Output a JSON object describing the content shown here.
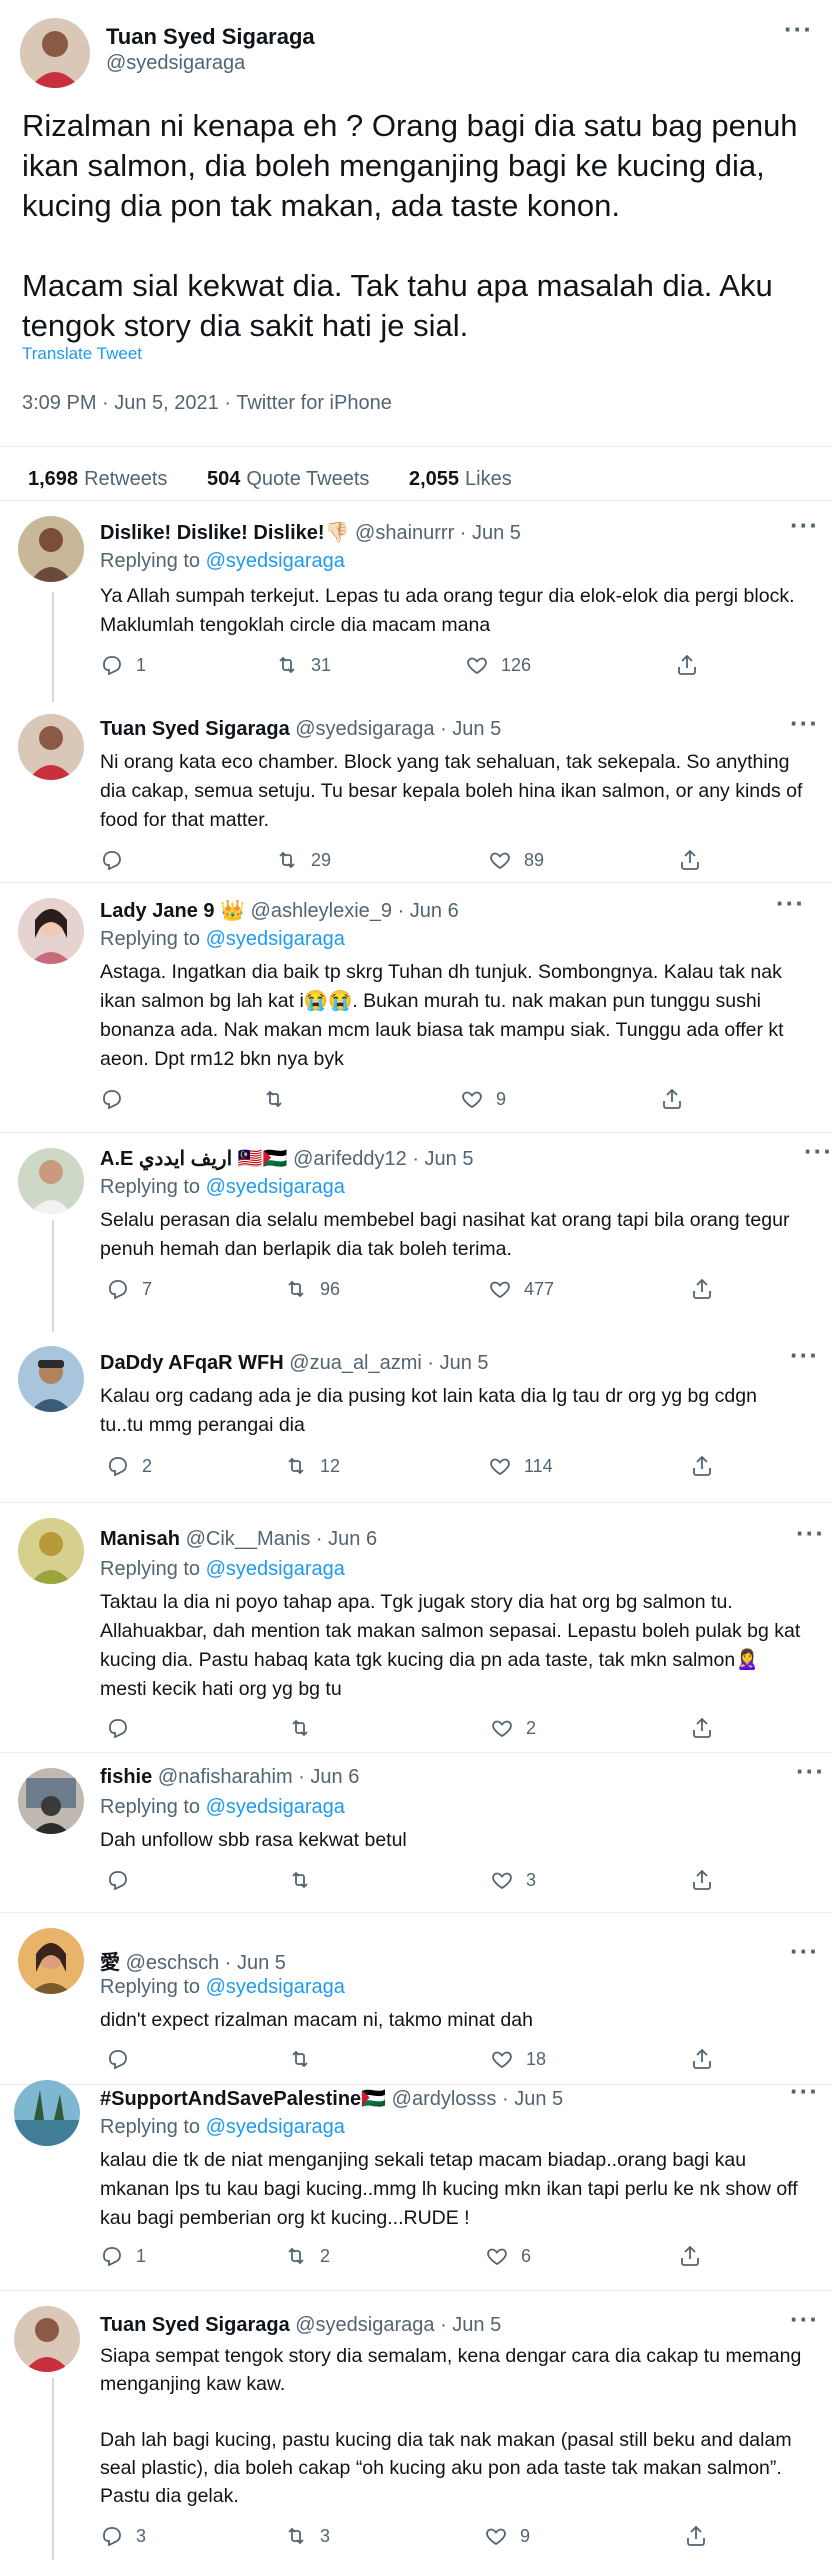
{
  "main_tweet": {
    "name": "Tuan Syed Sigaraga",
    "handle": "@syedsigaraga",
    "text": "Rizalman ni kenapa eh ? Orang bagi dia satu bag penuh ikan salmon, dia boleh menganjing bagi ke kucing dia, kucing dia pon tak makan, ada taste konon.\n\nMacam sial kekwat dia. Tak tahu apa masalah dia. Aku tengok story dia sakit hati je sial.",
    "translate": "Translate Tweet",
    "meta": "3:09 PM · Jun 5, 2021 · Twitter for iPhone",
    "stats": {
      "retweets_count": "1,698",
      "retweets_label": "Retweets",
      "quotes_count": "504",
      "quotes_label": "Quote Tweets",
      "likes_count": "2,055",
      "likes_label": "Likes"
    }
  },
  "replies": [
    {
      "name": "Dislike! Dislike! Dislike!👎🏻",
      "handle": "@shainurrr · Jun 5",
      "replying_prefix": "Replying to ",
      "replying_to": "@syedsigaraga",
      "text": "Ya Allah sumpah terkejut. Lepas tu ada orang tegur dia elok-elok dia pergi block. Maklumlah tengoklah circle dia macam mana",
      "reply_count": "1",
      "retweet_count": "31",
      "like_count": "126"
    },
    {
      "name": "Tuan Syed Sigaraga",
      "handle": "@syedsigaraga · Jun 5",
      "replying_prefix": "",
      "replying_to": "",
      "text": "Ni orang kata eco chamber. Block yang tak sehaluan, tak sekepala. So anything dia cakap, semua setuju. Tu besar kepala boleh hina ikan salmon, or any kinds of food for that matter.",
      "reply_count": "",
      "retweet_count": "29",
      "like_count": "89"
    },
    {
      "name": "Lady Jane 9 👑",
      "handle": "@ashleylexie_9 · Jun 6",
      "replying_prefix": "Replying to ",
      "replying_to": "@syedsigaraga",
      "text": "Astaga. Ingatkan dia baik tp skrg Tuhan dh tunjuk. Sombongnya. Kalau tak nak ikan salmon bg lah kat i😭😭. Bukan murah tu. nak makan pun tunggu sushi bonanza ada. Nak makan mcm lauk biasa tak mampu siak. Tunggu ada offer kt aeon. Dpt rm12 bkn nya byk",
      "reply_count": "",
      "retweet_count": "",
      "like_count": "9"
    },
    {
      "name": "A.E اريف ايددي 🇲🇾🇵🇸",
      "handle": "@arifeddy12 · Jun 5",
      "replying_prefix": "Replying to ",
      "replying_to": "@syedsigaraga",
      "text": "Selalu perasan dia selalu membebel bagi nasihat kat orang tapi bila orang tegur penuh hemah dan berlapik dia tak boleh terima.",
      "reply_count": "7",
      "retweet_count": "96",
      "like_count": "477"
    },
    {
      "name": "DaDdy AFqaR WFH",
      "handle": "@zua_al_azmi · Jun 5",
      "replying_prefix": "",
      "replying_to": "",
      "text": "Kalau org cadang ada je dia pusing kot lain kata dia lg tau dr org yg bg cdgn tu..tu mmg perangai dia",
      "reply_count": "2",
      "retweet_count": "12",
      "like_count": "114"
    },
    {
      "name": "Manisah",
      "handle": "@Cik__Manis · Jun 6",
      "replying_prefix": "Replying to ",
      "replying_to": "@syedsigaraga",
      "text": "Taktau la dia ni poyo tahap apa. Tgk jugak story dia hat org bg salmon tu. Allahuakbar, dah mention tak makan salmon sepasai. Lepastu boleh pulak bg kat kucing dia. Pastu habaq kata tgk kucing dia pn ada taste, tak mkn salmon🙎‍♀️ mesti kecik hati org yg bg tu",
      "reply_count": "",
      "retweet_count": "",
      "like_count": "2"
    },
    {
      "name": "fishie",
      "handle": "@nafisharahim · Jun 6",
      "replying_prefix": "Replying to ",
      "replying_to": "@syedsigaraga",
      "text": "Dah unfollow sbb rasa kekwat betul",
      "reply_count": "",
      "retweet_count": "",
      "like_count": "3"
    },
    {
      "name": "愛",
      "handle": "@eschsch · Jun 5",
      "replying_prefix": "Replying to ",
      "replying_to": "@syedsigaraga",
      "text": "didn't expect rizalman macam ni, takmo minat dah",
      "reply_count": "",
      "retweet_count": "",
      "like_count": "18"
    },
    {
      "name": "#SupportAndSavePalestine🇵🇸",
      "handle": "@ardylosss · Jun 5",
      "replying_prefix": "Replying to ",
      "replying_to": "@syedsigaraga",
      "text": "kalau die tk de niat menganjing sekali tetap macam biadap..orang bagi kau mkanan lps tu kau bagi kucing..mmg lh kucing mkn ikan tapi perlu ke nk show off kau bagi pemberian org kt kucing...RUDE !",
      "reply_count": "1",
      "retweet_count": "2",
      "like_count": "6"
    },
    {
      "name": "Tuan Syed Sigaraga",
      "handle": "@syedsigaraga · Jun 5",
      "replying_prefix": "Replying to ",
      "replying_to": "@syedsigaraga",
      "text": "Siapa sempat tengok story dia semalam, kena dengar cara dia cakap tu memang menganjing kaw kaw.\n\nDah lah bagi kucing, pastu kucing dia tak nak makan (pasal still beku and dalam seal plastic), dia boleh cakap “oh kucing aku pon ada taste tak makan salmon”. Pastu dia gelak.",
      "reply_count": "3",
      "retweet_count": "3",
      "like_count": "9"
    }
  ],
  "icons": {
    "more": "more-icon",
    "reply": "reply-icon",
    "retweet": "retweet-icon",
    "like": "like-icon",
    "share": "share-icon"
  }
}
